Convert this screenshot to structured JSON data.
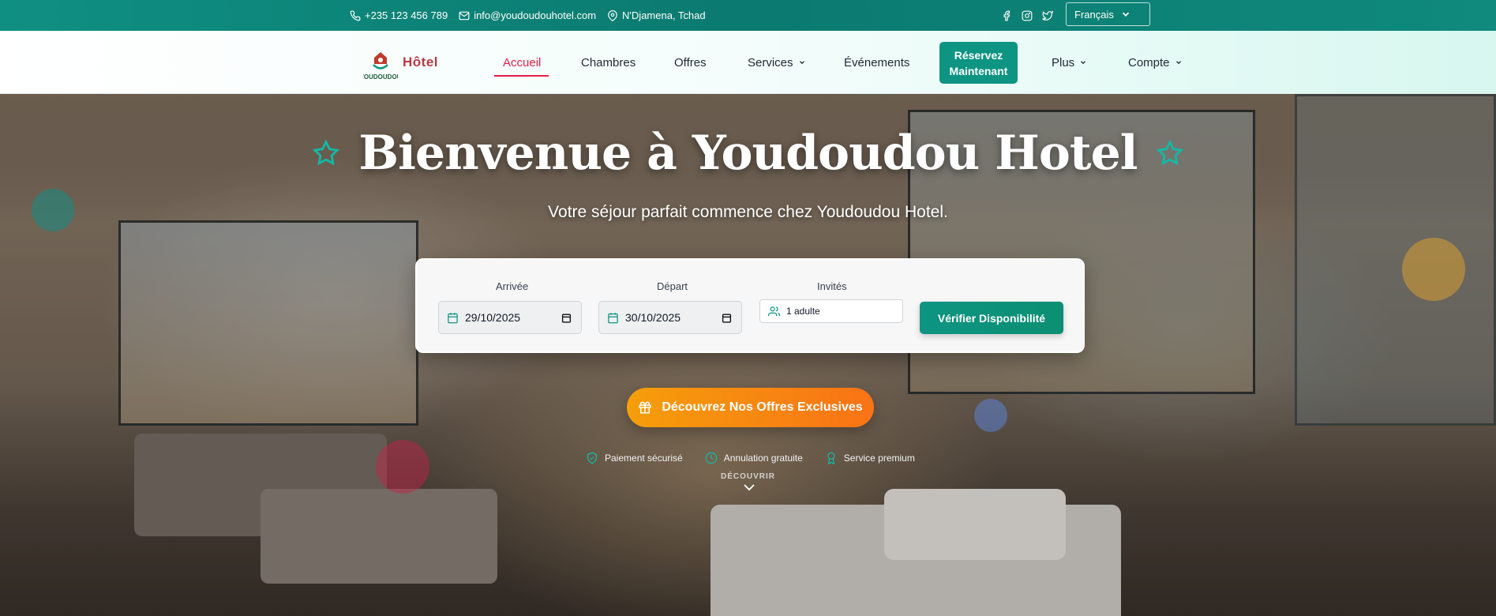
{
  "topbar": {
    "phone": "+235 123 456 789",
    "email": "info@youdoudouhotel.com",
    "location": "N'Djamena, Tchad",
    "social": [
      "facebook-icon",
      "instagram-icon",
      "twitter-icon"
    ],
    "language": "Français"
  },
  "nav": {
    "logo_text": "YOUDOUDOU",
    "brand": "Hôtel",
    "items": [
      {
        "label": "Accueil",
        "active": true
      },
      {
        "label": "Chambres"
      },
      {
        "label": "Offres"
      },
      {
        "label": "Services",
        "dropdown": true
      },
      {
        "label": "Événements"
      },
      {
        "label": "Plus",
        "dropdown": true
      },
      {
        "label": "Compte",
        "dropdown": true
      }
    ],
    "cta": "Réservez Maintenant"
  },
  "hero": {
    "title": "Bienvenue à Youdoudou Hotel",
    "subtitle": "Votre séjour parfait commence chez Youdoudou Hotel."
  },
  "booking": {
    "arrival_label": "Arrivée",
    "arrival_value": "29/10/2025",
    "departure_label": "Départ",
    "departure_value": "30/10/2025",
    "guests_label": "Invités",
    "guests_value": "1 adulte",
    "check_button": "Vérifier Disponibilité"
  },
  "offers_button": "Découvrez Nos Offres Exclusives",
  "badges": [
    "Paiement sécurisé",
    "Annulation gratuite",
    "Service premium"
  ],
  "discover": "DÉCOUVRIR",
  "colors": {
    "accent": "#0d9482",
    "active_nav": "#e11d48",
    "offers": "#f97316"
  }
}
